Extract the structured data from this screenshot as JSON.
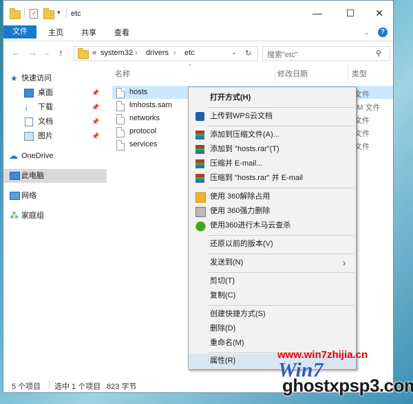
{
  "window": {
    "title": "etc",
    "minimize": "—",
    "maximize": "☐",
    "close": "✕",
    "help": "?"
  },
  "ribbon": {
    "tabs": [
      "文件",
      "主页",
      "共享",
      "查看"
    ]
  },
  "address": {
    "crumbs": [
      "«",
      "system32",
      "›",
      "drivers",
      "›",
      "etc"
    ],
    "search_placeholder": "搜索\"etc\""
  },
  "nav": {
    "items": [
      {
        "label": "快速访问"
      },
      {
        "label": "桌面"
      },
      {
        "label": "下载"
      },
      {
        "label": "文档"
      },
      {
        "label": "图片"
      },
      {
        "label": "OneDrive"
      },
      {
        "label": "此电脑"
      },
      {
        "label": "网络"
      },
      {
        "label": "家庭组"
      }
    ]
  },
  "columns": {
    "name": "名称",
    "date": "修改日期",
    "type": "类型"
  },
  "files": [
    {
      "name": "hosts",
      "type": "文件"
    },
    {
      "name": "lmhosts.sam",
      "type": "AM 文件"
    },
    {
      "name": "networks",
      "type": "文件"
    },
    {
      "name": "protocol",
      "type": "文件"
    },
    {
      "name": "services",
      "type": "文件"
    }
  ],
  "status": {
    "count": "5 个项目",
    "selected": "选中 1 个项目",
    "size": "823 字节"
  },
  "menu": {
    "open_with": "打开方式(H)",
    "upload_wps": "上传到WPS云文档",
    "add_archive": "添加到压缩文件(A)...",
    "add_hosts_rar": "添加到 \"hosts.rar\"(T)",
    "compress_email": "压缩并 E-mail...",
    "compress_hosts_email": "压缩到 \"hosts.rar\" 并 E-mail",
    "unlock_360": "使用 360解除占用",
    "force_delete_360": "使用 360强力删除",
    "trojan_scan_360": "使用360进行木马云查杀",
    "restore_prev": "还原以前的版本(V)",
    "send_to": "发送到(N)",
    "cut": "剪切(T)",
    "copy": "复制(C)",
    "create_shortcut": "创建快捷方式(S)",
    "delete": "删除(D)",
    "rename": "重命名(M)",
    "properties": "属性(R)"
  },
  "watermark": {
    "url": "www.win7zhijia.cn",
    "brand": "Win7",
    "site": "ghostxpsp3.com"
  },
  "colors": {
    "accent": "#1979ca",
    "selection": "#cce8ff",
    "menu_bg": "#f2f2f2",
    "watermark_red": "#e50000"
  }
}
